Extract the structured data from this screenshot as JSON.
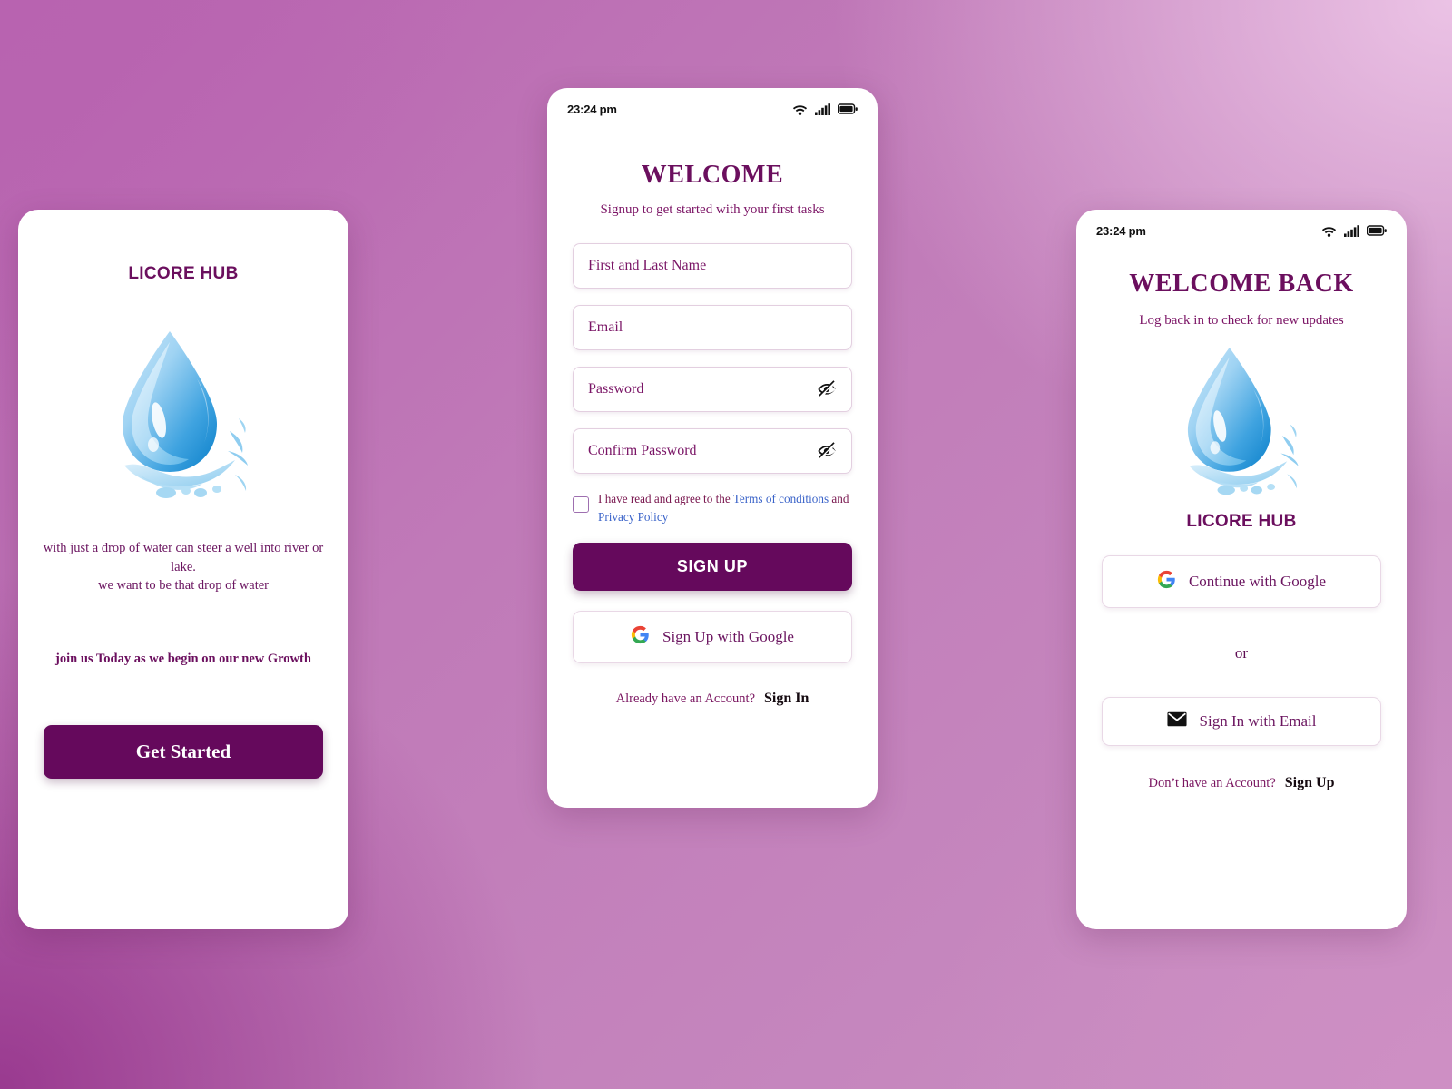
{
  "background": {
    "gradient_from": "#b863b0",
    "gradient_to": "#ecc4e6",
    "gradient_dark": "#96348c"
  },
  "theme": {
    "primary": "#65095c",
    "title_color": "#6b0f5e",
    "link_color": "#3a63c9"
  },
  "onboarding": {
    "brand": "LICORE HUB",
    "logo_icon": "water-drop-icon",
    "tagline_line1": "with just a drop of water can steer a well into river or",
    "tagline_line2": "lake.",
    "tagline_line3": "we want to be that drop of water",
    "growth_text": "join us Today as we begin on our new Growth",
    "cta_label": "Get Started"
  },
  "signup": {
    "status": {
      "time": "23:24 pm",
      "wifi_icon": "wifi-icon",
      "signal_icon": "signal-bars-icon",
      "battery_icon": "battery-icon"
    },
    "title": "WELCOME",
    "subtitle": "Signup to get started with your first tasks",
    "fields": [
      {
        "name": "full-name",
        "placeholder": "First and Last Name",
        "value": "",
        "has_toggle": false
      },
      {
        "name": "email",
        "placeholder": "Email",
        "value": "",
        "has_toggle": false
      },
      {
        "name": "password",
        "placeholder": "Password",
        "value": "",
        "has_toggle": true
      },
      {
        "name": "confirm-password",
        "placeholder": "Confirm Password",
        "value": "",
        "has_toggle": true
      }
    ],
    "terms": {
      "checked": false,
      "lead": "I have read and agree to the ",
      "link1": "Terms of conditions",
      "mid": " and ",
      "link2": "Privacy Policy"
    },
    "submit_label": "SIGN UP",
    "google_label": "Sign Up with Google",
    "google_icon": "google-g-icon",
    "footer_question": "Already have an Account?",
    "footer_action": "Sign In"
  },
  "signin": {
    "status": {
      "time": "23:24 pm",
      "wifi_icon": "wifi-icon",
      "signal_icon": "signal-bars-icon",
      "battery_icon": "battery-icon"
    },
    "title": "WELCOME BACK",
    "subtitle": "Log back in to check for new updates",
    "logo_icon": "water-drop-icon",
    "brand": "LICORE HUB",
    "google_label": "Continue with Google",
    "google_icon": "google-g-icon",
    "divider_label": "or",
    "email_label": "Sign In with Email",
    "email_icon": "envelope-icon",
    "footer_question": "Don’t have an Account?",
    "footer_action": "Sign Up"
  }
}
